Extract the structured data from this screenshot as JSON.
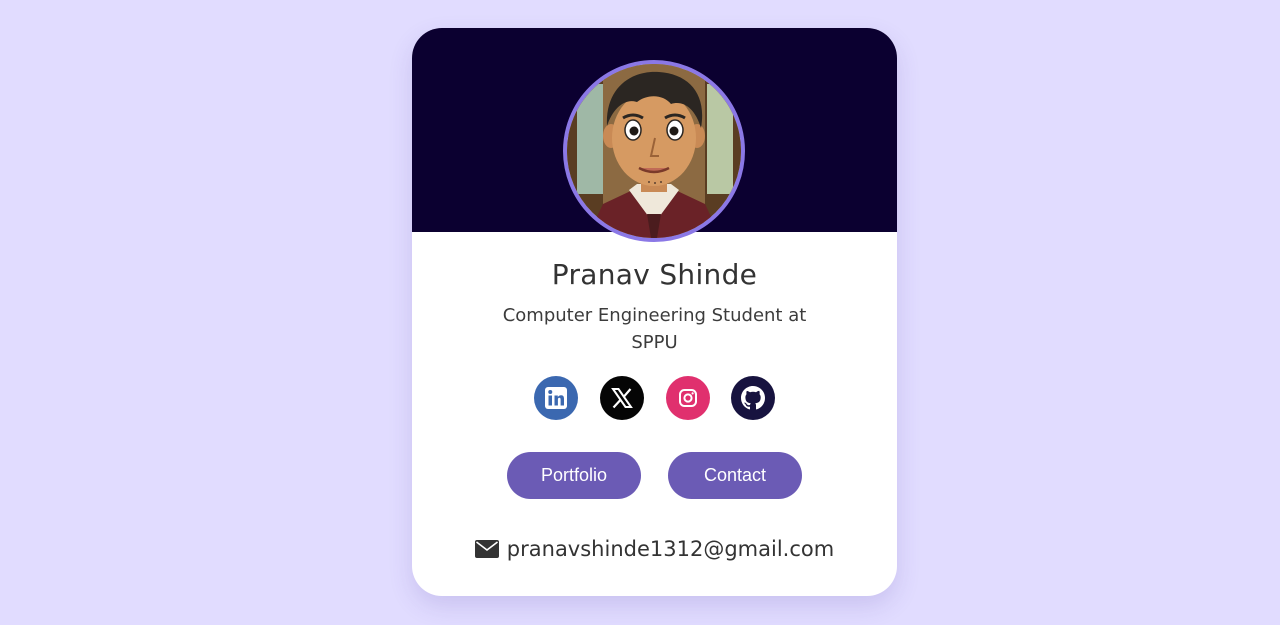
{
  "profile": {
    "name": "Pranav Shinde",
    "subtitle": "Computer Engineering Student at SPPU",
    "email": "pranavshinde1312@gmail.com",
    "avatar_icon": "profile-avatar-illustration"
  },
  "socials": [
    {
      "name": "linkedin",
      "icon": "linkedin-icon",
      "color": "#3b68b0"
    },
    {
      "name": "x",
      "icon": "x-icon",
      "color": "#050505"
    },
    {
      "name": "instagram",
      "icon": "instagram-icon",
      "color": "#e0306e"
    },
    {
      "name": "github",
      "icon": "github-icon",
      "color": "#17133f"
    }
  ],
  "buttons": {
    "portfolio": "Portfolio",
    "contact": "Contact"
  },
  "colors": {
    "page_background": "#e1dcff",
    "banner": "#0b0030",
    "accent": "#6b5bb5",
    "avatar_ring": "#8b78e6"
  }
}
